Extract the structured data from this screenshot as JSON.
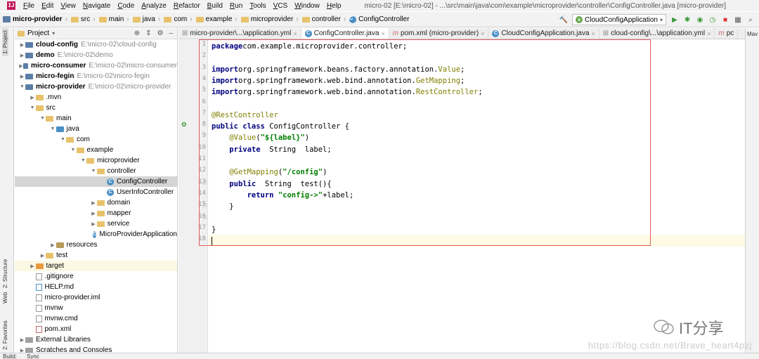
{
  "menubar": {
    "items": [
      "File",
      "Edit",
      "View",
      "Navigate",
      "Code",
      "Analyze",
      "Refactor",
      "Build",
      "Run",
      "Tools",
      "VCS",
      "Window",
      "Help"
    ],
    "window_title": "micro-02 [E:\\micro-02] - ...\\src\\main\\java\\com\\example\\microprovider\\controller\\ConfigController.java [micro-provider]"
  },
  "breadcrumb": [
    "micro-provider",
    "src",
    "main",
    "java",
    "com",
    "example",
    "microprovider",
    "controller",
    "ConfigController"
  ],
  "run_config": "CloudConfigApplication",
  "project_panel": {
    "title": "Project",
    "tree": [
      {
        "label": "cloud-config",
        "path": "E:\\micro-02\\cloud-config",
        "indent": 0,
        "arrow": "right",
        "bold": true,
        "icon": "module"
      },
      {
        "label": "demo",
        "path": "E:\\micro-02\\demo",
        "indent": 0,
        "arrow": "right",
        "bold": true,
        "icon": "module"
      },
      {
        "label": "micro-consumer",
        "path": "E:\\micro-02\\micro-consumer",
        "indent": 0,
        "arrow": "right",
        "bold": true,
        "icon": "module"
      },
      {
        "label": "micro-fegin",
        "path": "E:\\micro-02\\micro-fegin",
        "indent": 0,
        "arrow": "right",
        "bold": true,
        "icon": "module"
      },
      {
        "label": "micro-provider",
        "path": "E:\\micro-02\\micro-provider",
        "indent": 0,
        "arrow": "down",
        "bold": true,
        "icon": "module"
      },
      {
        "label": ".mvn",
        "path": "",
        "indent": 1,
        "arrow": "right",
        "bold": false,
        "icon": "folder"
      },
      {
        "label": "src",
        "path": "",
        "indent": 1,
        "arrow": "down",
        "bold": false,
        "icon": "folder"
      },
      {
        "label": "main",
        "path": "",
        "indent": 2,
        "arrow": "down",
        "bold": false,
        "icon": "folder"
      },
      {
        "label": "java",
        "path": "",
        "indent": 3,
        "arrow": "down",
        "bold": false,
        "icon": "folder-src"
      },
      {
        "label": "com",
        "path": "",
        "indent": 4,
        "arrow": "down",
        "bold": false,
        "icon": "package"
      },
      {
        "label": "example",
        "path": "",
        "indent": 5,
        "arrow": "down",
        "bold": false,
        "icon": "package"
      },
      {
        "label": "microprovider",
        "path": "",
        "indent": 6,
        "arrow": "down",
        "bold": false,
        "icon": "package"
      },
      {
        "label": "controller",
        "path": "",
        "indent": 7,
        "arrow": "down",
        "bold": false,
        "icon": "package"
      },
      {
        "label": "ConfigController",
        "path": "",
        "indent": 8,
        "arrow": "none",
        "bold": false,
        "icon": "class",
        "selected": true
      },
      {
        "label": "UserInfoController",
        "path": "",
        "indent": 8,
        "arrow": "none",
        "bold": false,
        "icon": "class"
      },
      {
        "label": "domain",
        "path": "",
        "indent": 7,
        "arrow": "right",
        "bold": false,
        "icon": "package"
      },
      {
        "label": "mapper",
        "path": "",
        "indent": 7,
        "arrow": "right",
        "bold": false,
        "icon": "package"
      },
      {
        "label": "service",
        "path": "",
        "indent": 7,
        "arrow": "right",
        "bold": false,
        "icon": "package"
      },
      {
        "label": "MicroProviderApplication",
        "path": "",
        "indent": 7,
        "arrow": "none",
        "bold": false,
        "icon": "class-app"
      },
      {
        "label": "resources",
        "path": "",
        "indent": 3,
        "arrow": "right",
        "bold": false,
        "icon": "folder-res"
      },
      {
        "label": "test",
        "path": "",
        "indent": 2,
        "arrow": "right",
        "bold": false,
        "icon": "folder"
      },
      {
        "label": "target",
        "path": "",
        "indent": 1,
        "arrow": "right",
        "bold": false,
        "icon": "folder-target",
        "highlight": true
      },
      {
        "label": ".gitignore",
        "path": "",
        "indent": 1,
        "arrow": "none",
        "bold": false,
        "icon": "file"
      },
      {
        "label": "HELP.md",
        "path": "",
        "indent": 1,
        "arrow": "none",
        "bold": false,
        "icon": "file-md"
      },
      {
        "label": "micro-provider.iml",
        "path": "",
        "indent": 1,
        "arrow": "none",
        "bold": false,
        "icon": "file"
      },
      {
        "label": "mvnw",
        "path": "",
        "indent": 1,
        "arrow": "none",
        "bold": false,
        "icon": "file"
      },
      {
        "label": "mvnw.cmd",
        "path": "",
        "indent": 1,
        "arrow": "none",
        "bold": false,
        "icon": "file"
      },
      {
        "label": "pom.xml",
        "path": "",
        "indent": 1,
        "arrow": "none",
        "bold": false,
        "icon": "file-maven"
      },
      {
        "label": "External Libraries",
        "path": "",
        "indent": 0,
        "arrow": "right",
        "bold": false,
        "icon": "library"
      },
      {
        "label": "Scratches and Consoles",
        "path": "",
        "indent": 0,
        "arrow": "right",
        "bold": false,
        "icon": "scratch"
      }
    ]
  },
  "tabs": [
    {
      "label": "micro-provider\\...\\application.yml",
      "icon": "yml",
      "active": false
    },
    {
      "label": "ConfigController.java",
      "icon": "class",
      "active": true
    },
    {
      "label": "pom.xml (micro-provider)",
      "icon": "maven",
      "active": false
    },
    {
      "label": "CloudConfigApplication.java",
      "icon": "class",
      "active": false
    },
    {
      "label": "cloud-config\\...\\application.yml",
      "icon": "yml",
      "active": false
    },
    {
      "label": "pc",
      "icon": "maven",
      "active": false
    }
  ],
  "left_stripe": {
    "project": "1: Project",
    "structure": "2: Structure",
    "web": "Web",
    "favorites": "2: Favorites"
  },
  "right_stripe": {
    "maven": "Mav"
  },
  "code": {
    "line_numbers": [
      "1",
      "2",
      "3",
      "4",
      "5",
      "6",
      "7",
      "8",
      "9",
      "10",
      "11",
      "12",
      "13",
      "14",
      "15",
      "16",
      "17",
      "18"
    ],
    "lines": [
      [
        [
          "kw",
          "package"
        ],
        [
          "",
          "com.example.microprovider.controller;"
        ]
      ],
      [],
      [
        [
          "kw",
          "import"
        ],
        [
          "",
          "org.springframework.beans.factory.annotation."
        ],
        [
          "ann",
          "Value"
        ],
        [
          "",
          ";"
        ]
      ],
      [
        [
          "kw",
          "import"
        ],
        [
          "",
          "org.springframework.web.bind.annotation."
        ],
        [
          "ann",
          "GetMapping"
        ],
        [
          "",
          ";"
        ]
      ],
      [
        [
          "kw",
          "import"
        ],
        [
          "",
          "org.springframework.web.bind.annotation."
        ],
        [
          "ann",
          "RestController"
        ],
        [
          "",
          ";"
        ]
      ],
      [],
      [
        [
          "ann",
          "@RestController"
        ]
      ],
      [
        [
          "kw",
          "public class "
        ],
        [
          "",
          "ConfigController {"
        ]
      ],
      [
        [
          "",
          "    "
        ],
        [
          "ann",
          "@Value"
        ],
        [
          "",
          "("
        ],
        [
          "str",
          "\"${label}\""
        ],
        [
          "",
          ")"
        ]
      ],
      [
        [
          "",
          "    "
        ],
        [
          "kw",
          "private  "
        ],
        [
          "",
          "String  label;"
        ]
      ],
      [],
      [
        [
          "",
          "    "
        ],
        [
          "ann",
          "@GetMapping"
        ],
        [
          "",
          "("
        ],
        [
          "str",
          "\"/config\""
        ],
        [
          "",
          ")"
        ]
      ],
      [
        [
          "",
          "    "
        ],
        [
          "kw",
          "public  "
        ],
        [
          "",
          "String  test(){"
        ]
      ],
      [
        [
          "",
          "        "
        ],
        [
          "kw",
          "return "
        ],
        [
          "str",
          "\"config->\""
        ],
        [
          "",
          "+label;"
        ]
      ],
      [
        [
          "",
          "    }"
        ]
      ],
      [],
      [
        [
          "",
          "}"
        ]
      ],
      []
    ]
  },
  "statusbar": {
    "build": "Build:",
    "sync": "Sync"
  },
  "watermark": "https://blog.csdn.net/Brave_heart4pzj",
  "wechat_label": "IT分享"
}
